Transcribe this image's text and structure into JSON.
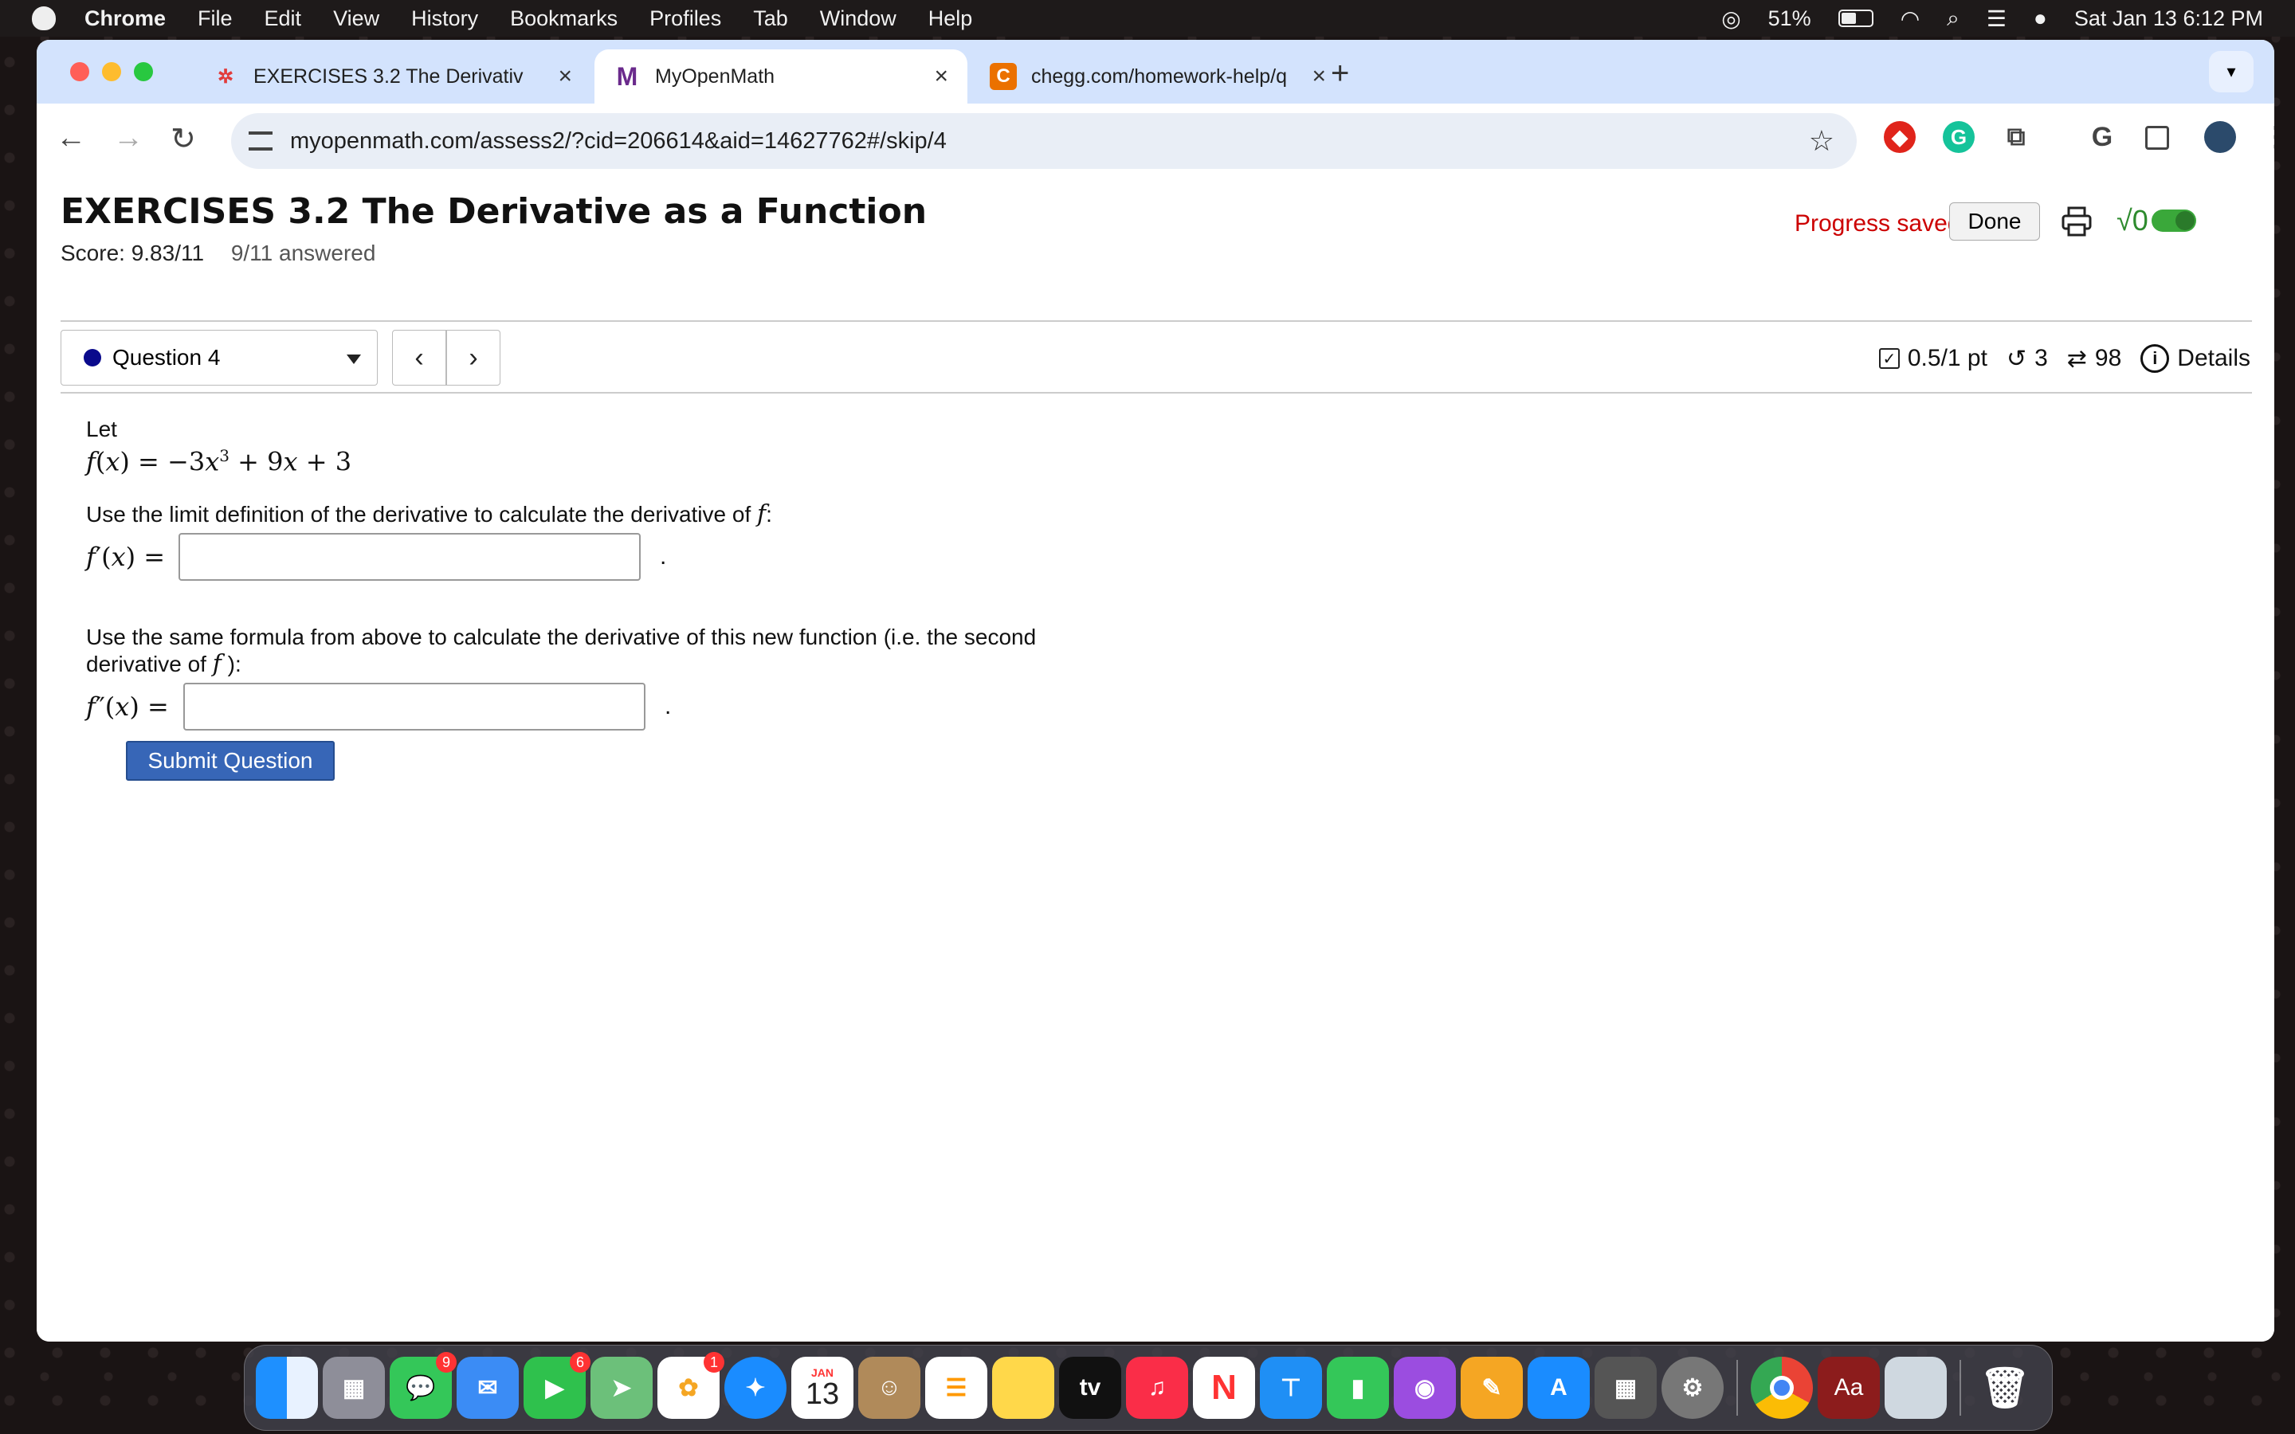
{
  "menubar": {
    "app": "Chrome",
    "items": [
      "File",
      "Edit",
      "View",
      "History",
      "Bookmarks",
      "Profiles",
      "Tab",
      "Window",
      "Help"
    ],
    "battery": "51%",
    "datetime": "Sat Jan 13  6:12 PM"
  },
  "tabs": [
    {
      "label": "EXERCISES 3.2 The Derivativ",
      "icon": "canvas-icon"
    },
    {
      "label": "MyOpenMath",
      "icon": "myopenmath-icon"
    },
    {
      "label": "chegg.com/homework-help/q",
      "icon": "chegg-icon"
    }
  ],
  "address_bar": {
    "url": "myopenmath.com/assess2/?cid=206614&aid=14627762#/skip/4"
  },
  "assessment": {
    "title": "EXERCISES 3.2 The Derivative as a Function",
    "score": "Score: 9.83/11",
    "answered": "9/11 answered",
    "progress_saved": "Progress saved",
    "done_label": "Done"
  },
  "question_nav": {
    "selected": "Question 4",
    "points": "0.5/1 pt",
    "retries": "3",
    "attempts": "98",
    "details_label": "Details"
  },
  "question": {
    "let": "Let",
    "part1": "Use the limit definition of the derivative to calculate the derivative of",
    "part2a": "Use the same formula from above to calculate the derivative of this new function (i.e. the second",
    "part2b": "derivative of",
    "submit_label": "Submit Question"
  },
  "dock": {
    "calendar_month": "JAN",
    "calendar_day": "13",
    "messages_badge": "9",
    "facetime_badge": "6",
    "photos_badge": "1"
  },
  "colors": {
    "accent": "#3766b7",
    "progress": "#cc0000",
    "tab_bar": "#d3e3fd"
  }
}
